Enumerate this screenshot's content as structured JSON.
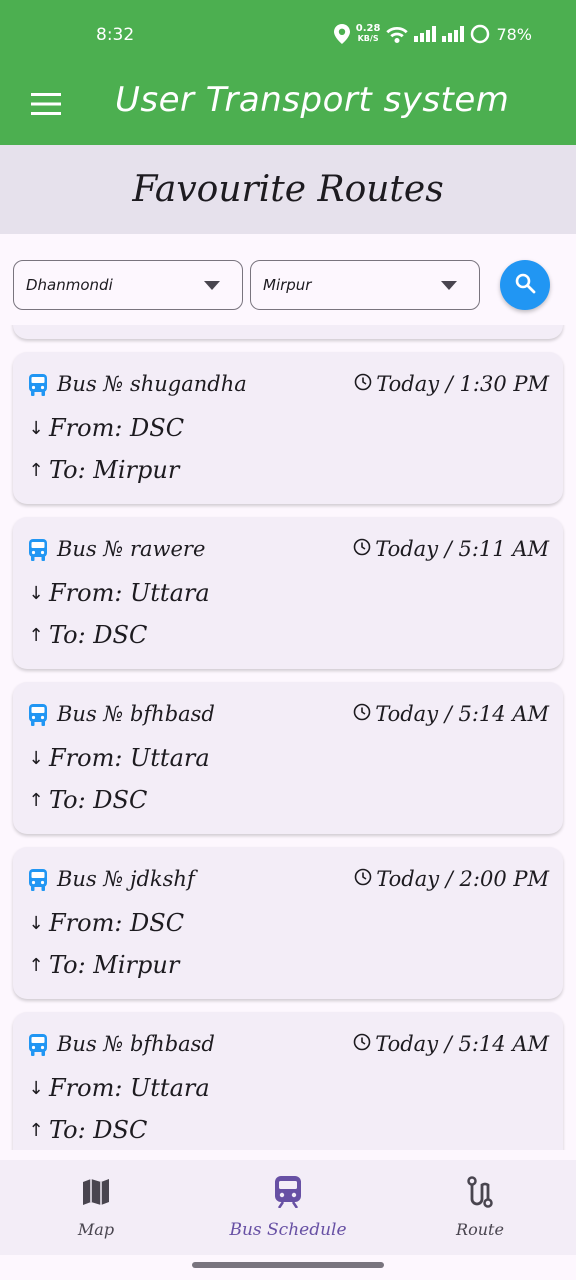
{
  "status_bar": {
    "time": "8:32",
    "net_speed_value": "0.28",
    "net_speed_unit": "KB/S",
    "battery": "78%"
  },
  "app_bar": {
    "title": "User Transport system",
    "menu_icon": "hamburger-icon",
    "color": "#4caf50"
  },
  "section": {
    "title": "Favourite Routes"
  },
  "filters": {
    "from_value": "Dhanmondi",
    "to_value": "Mirpur",
    "search_icon": "search-icon",
    "search_color": "#2196f3"
  },
  "routes": [
    {
      "bus_label": "Bus № shugandha",
      "time": "Today / 1:30 PM",
      "from": "From: DSC",
      "to": "To: Mirpur"
    },
    {
      "bus_label": "Bus № rawere",
      "time": "Today / 5:11 AM",
      "from": "From: Uttara",
      "to": "To: DSC"
    },
    {
      "bus_label": "Bus № bfhbasd",
      "time": "Today / 5:14 AM",
      "from": "From: Uttara",
      "to": "To: DSC"
    },
    {
      "bus_label": "Bus № jdkshf",
      "time": "Today / 2:00 PM",
      "from": "From: DSC",
      "to": "To: Mirpur"
    },
    {
      "bus_label": "Bus № bfhbasd",
      "time": "Today / 5:14 AM",
      "from": "From: Uttara",
      "to": "To: DSC"
    }
  ],
  "bottom_nav": {
    "items": [
      {
        "label": "Map",
        "icon": "map-icon"
      },
      {
        "label": "Bus Schedule",
        "icon": "train-icon",
        "active": true
      },
      {
        "label": "Route",
        "icon": "route-icon"
      }
    ]
  },
  "colors": {
    "accent": "#6750a4",
    "bus_icon": "#2196f3"
  }
}
